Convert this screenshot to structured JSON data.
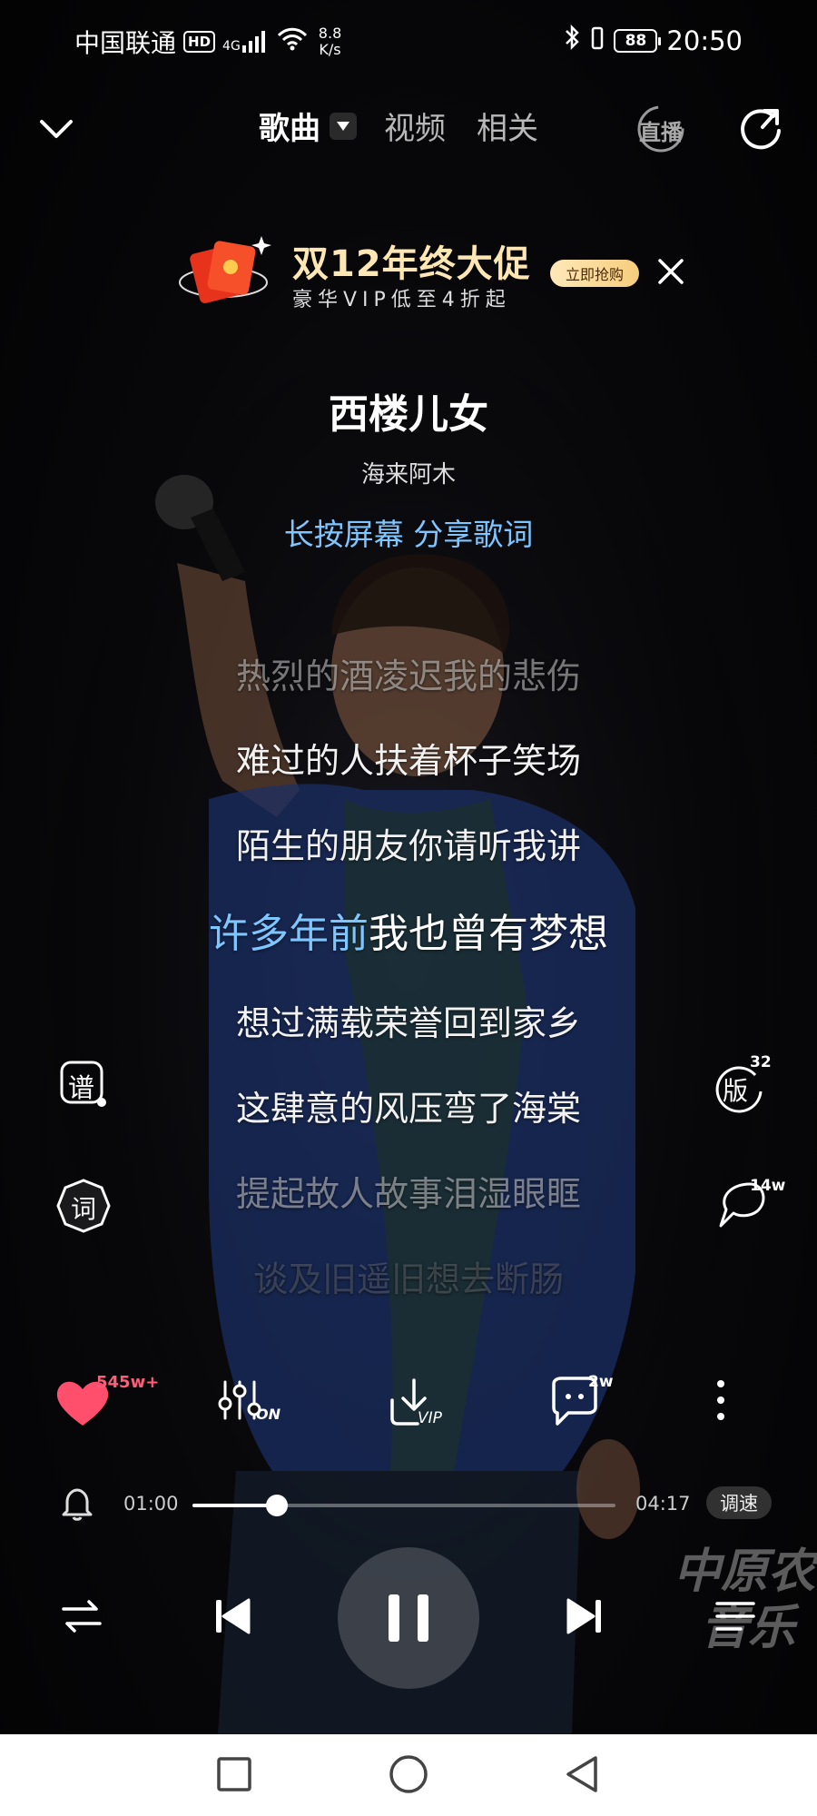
{
  "status_bar": {
    "carrier": "中国联通",
    "hd": "HD",
    "signal": "4G",
    "net_speed_value": "8.8",
    "net_speed_unit": "K/s",
    "battery": "88",
    "time": "20:50"
  },
  "nav": {
    "tabs": [
      {
        "label": "歌曲",
        "active": true
      },
      {
        "label": "视频",
        "active": false
      },
      {
        "label": "相关",
        "active": false
      }
    ],
    "live_label": "直播"
  },
  "promo": {
    "title": "双12年终大促",
    "subtitle": "豪华VIP低至4折起",
    "button": "立即抢购"
  },
  "song": {
    "title": "西楼儿女",
    "artist": "海来阿木",
    "share_hint": "长按屏幕 分享歌词"
  },
  "lyrics": {
    "line1": "热烈的酒凌迟我的悲伤",
    "line2": "难过的人扶着杯子笑场",
    "line3": "陌生的朋友你请听我讲",
    "current_sung": "许多年前",
    "current_rest": "我也曾有梦想",
    "line5": "想过满载荣誉回到家乡",
    "line6": "这肆意的风压弯了海棠",
    "line7": "提起故人故事泪湿眼眶",
    "line8": "谈及旧遥旧想去断肠"
  },
  "side_buttons": {
    "score_label": "谱",
    "lyrics_label": "词",
    "version_label": "版",
    "version_count": "32",
    "comments_count": "14w"
  },
  "actions": {
    "like_count": "545w+",
    "equalizer_state": "ON",
    "download_tag": "VIP",
    "comment_count": "2w"
  },
  "progress": {
    "current_time": "01:00",
    "total_time": "04:17",
    "fraction": 0.2,
    "speed_label": "调速"
  },
  "watermark": {
    "line1": "中原农",
    "line2": "音乐"
  },
  "colors": {
    "accent": "#7ec6ff",
    "like": "#ff4f6d",
    "promo_gold": "#ffe7b3"
  }
}
